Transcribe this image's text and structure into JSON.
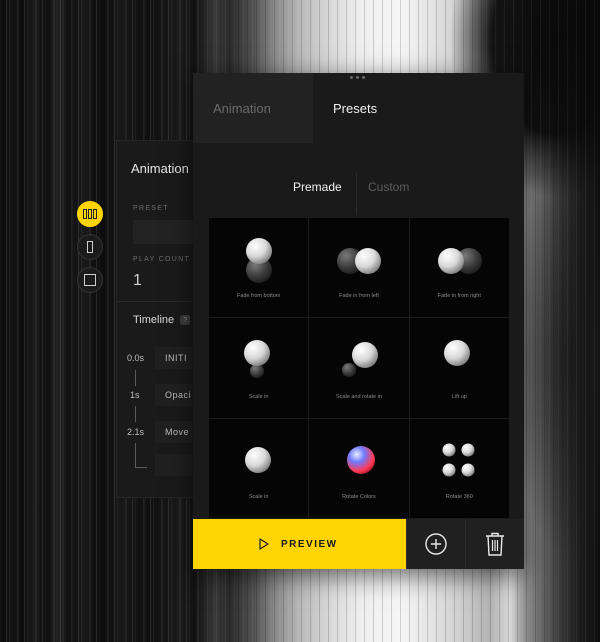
{
  "left_panel": {
    "title": "Animation",
    "preset_label": "PRESET",
    "play_count_label": "PLAY COUNT",
    "play_count_value": "1",
    "timeline_label": "Timeline",
    "timeline_help": "?",
    "rows": [
      {
        "time": "0.0s",
        "label": "INITI"
      },
      {
        "time": "1s",
        "label": "Opaci"
      },
      {
        "time": "2.1s",
        "label": "Move"
      }
    ]
  },
  "side_controls": [
    {
      "icon": "columns-icon",
      "active": true
    },
    {
      "icon": "single-column-icon",
      "active": false
    },
    {
      "icon": "square-icon",
      "active": false
    }
  ],
  "tabs": [
    "Animation",
    "Presets"
  ],
  "active_tab": "Presets",
  "subtabs": [
    "Premade",
    "Custom"
  ],
  "active_subtab": "Premade",
  "presets": [
    {
      "label": "Fade from bottom"
    },
    {
      "label": "Fade in from left"
    },
    {
      "label": "Fade in from right"
    },
    {
      "label": "Scale in"
    },
    {
      "label": "Scale and rotate in"
    },
    {
      "label": "Lift up"
    },
    {
      "label": "Scale in"
    },
    {
      "label": "Rotate Colors"
    },
    {
      "label": "Rotate 360"
    }
  ],
  "actions": {
    "preview_label": "PREVIEW",
    "add_icon": "plus-circle-icon",
    "delete_icon": "trash-icon"
  },
  "colors": {
    "accent": "#ffd400",
    "panel": "#1a1a1a"
  }
}
